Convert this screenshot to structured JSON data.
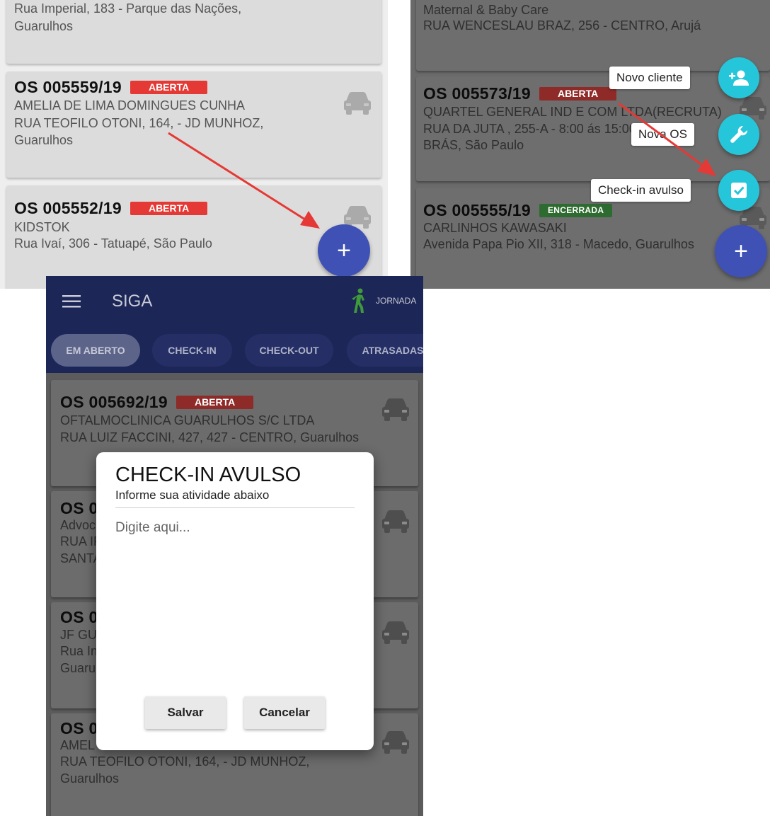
{
  "panel_a": {
    "top_card": {
      "line1": "Rua Imperial, 183 - Parque das Nações,",
      "line2": "Guarulhos"
    },
    "card1": {
      "os": "OS 005559/19",
      "status": "ABERTA",
      "line1": "AMELIA DE LIMA DOMINGUES CUNHA",
      "line2": "RUA TEOFILO OTONI, 164,  - JD MUNHOZ,",
      "line3": "Guarulhos"
    },
    "card2": {
      "os": "OS 005552/19",
      "status": "ABERTA",
      "line1": "KIDSTOK",
      "line2": "Rua Ivaí, 306 - Tatuapé, São Paulo"
    },
    "fab_label": "+"
  },
  "panel_b": {
    "top_card": {
      "line1": "Maternal & Baby Care",
      "line2": "RUA WENCESLAU BRAZ, 256 - CENTRO, Arujá"
    },
    "card1": {
      "os": "OS 005573/19",
      "status": "ABERTA",
      "line1": "QUARTEL GENERAL IND E COM LTDA(RECRUTA)",
      "line2": "RUA DA JUTA , 255-A -  8:00  ás  15:00 - S. -",
      "line3": "BRÁS, São Paulo"
    },
    "card2": {
      "os": "OS 005555/19",
      "status": "ENCERRADA",
      "line1": "CARLINHOS KAWASAKI",
      "line2": "Avenida Papa Pio XII, 318 - Macedo, Guarulhos"
    },
    "fab_menu": {
      "novo_cliente": "Novo cliente",
      "nova_os": "Nova OS",
      "checkin_avulso": "Check-in avulso",
      "fab_label": "+"
    }
  },
  "panel_c": {
    "app_title": "SIGA",
    "jornada": "JORNADA",
    "tabs": [
      "EM ABERTO",
      "CHECK-IN",
      "CHECK-OUT",
      "ATRASADAS"
    ],
    "card1": {
      "os": "OS 005692/19",
      "status": "ABERTA",
      "line1": "OFTALMOCLINICA GUARULHOS S/C LTDA",
      "line2": "RUA LUIZ FACCINI, 427, 427 - CENTRO, Guarulhos"
    },
    "card2": {
      "os": "OS 0",
      "line1": "Advoc",
      "line2": "RUA IF",
      "line3": "SANTA"
    },
    "card3": {
      "os": "OS 0",
      "line1": "JF GU",
      "line2": "Rua In",
      "line3": "Guaru"
    },
    "card4": {
      "os": "OS 0",
      "line1": "AMEL",
      "line2": "RUA TEOFILO OTONI, 164,  - JD MUNHOZ,",
      "line3": "Guarulhos"
    },
    "dialog": {
      "title": "CHECK-IN AVULSO",
      "subtitle": "Informe sua atividade abaixo",
      "placeholder": "Digite aqui...",
      "save": "Salvar",
      "cancel": "Cancelar"
    }
  },
  "colors": {
    "badge_aberta": "#e53935",
    "badge_encerrada": "#43a047",
    "fab_primary": "#3f51b5",
    "fab_mini": "#26c6da",
    "arrow": "#e53935",
    "appbar": "#1c2657"
  }
}
